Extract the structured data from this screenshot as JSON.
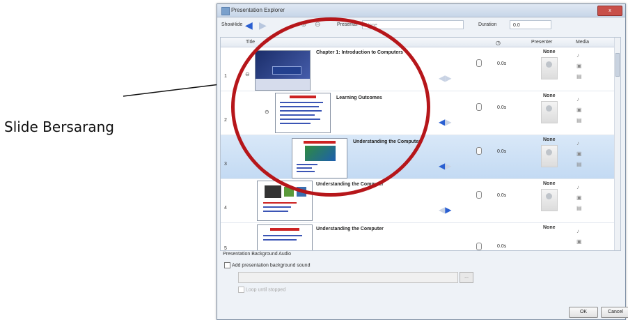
{
  "annotation": {
    "label": "Slide Bersarang"
  },
  "window": {
    "title": "Presentation Explorer",
    "close_label": "x"
  },
  "toolbar": {
    "show": "Show",
    "hide": "Hide",
    "presenter_label": "Presenter",
    "presenter_value": "None",
    "duration_label": "Duration",
    "duration_value": "0.0"
  },
  "grid": {
    "columns": {
      "title": "Title",
      "presenter": "Presenter",
      "media": "Media"
    },
    "rows": [
      {
        "num": "1",
        "title": "Chapter 1: Introduction to Computers",
        "duration": "0.0s",
        "presenter": "None",
        "selected": false
      },
      {
        "num": "2",
        "title": "Learning Outcomes",
        "duration": "0.0s",
        "presenter": "None",
        "selected": false
      },
      {
        "num": "3",
        "title": "Understanding the Computer",
        "duration": "0.0s",
        "presenter": "None",
        "selected": true
      },
      {
        "num": "4",
        "title": "Understanding the Computer",
        "duration": "0.0s",
        "presenter": "None",
        "selected": false
      },
      {
        "num": "5",
        "title": "Understanding the Computer",
        "duration": "0.0s",
        "presenter": "None",
        "selected": false
      }
    ]
  },
  "audio": {
    "section_label": "Presentation Background Audio",
    "checkbox_label": "Add presentation background sound",
    "browse_label": "...",
    "loop_label": "Loop until stopped"
  },
  "buttons": {
    "ok": "OK",
    "cancel": "Cancel"
  },
  "colors": {
    "highlight_ring": "#b6161a",
    "selected_row": "#c3daf3",
    "arrow": "#2a5fd1"
  }
}
